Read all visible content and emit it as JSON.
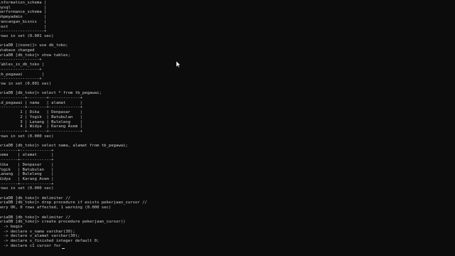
{
  "terminal": {
    "lines": [
      "information_schema |",
      "mysql              |",
      "performance_schema |",
      "phpmyadmin         |",
      "rancangan_bisnis   |",
      "test               |",
      "-------------------+",
      "rows in set (0.001 sec)",
      "",
      "ariaDB [(none)]> use db_toko;",
      "atabase changed",
      "ariaDB [db_toko]> show tables;",
      "-----------------+",
      "Tables_in_db_toko |",
      "-----------------+",
      "tb_pegawai        |",
      "-----------------+",
      "row in set (0.001 sec)",
      "",
      "ariaDB [db_toko]> select * from tb_pegawai;",
      "-----------+--------+-------------+",
      "id_pegawai | nama   | alamat      |",
      "-----------+--------+-------------+",
      "         1 | Dika   | Denpasar    |",
      "         2 | Yogik  | Batubulan   |",
      "         3 | Lanang | Buleleng    |",
      "         4 | Widya  | Karang Asem |",
      "-----------+--------+-------------+",
      "rows in set (0.000 sec)",
      "",
      "ariaDB [db_toko]> select nama, alamat from tb_pegawai;",
      "--------+-------------+",
      "nama    | alamat      |",
      "--------+-------------+",
      "Dika    | Denpasar    |",
      "Yogik   | Batubulan   |",
      "Lanang  | Buleleng    |",
      "Widya   | Karang Asem |",
      "--------+-------------+",
      "rows in set (0.000 sec)",
      "",
      "ariaDB [db_toko]> delimiter //",
      "ariaDB [db_toko]> drop procedure if exists pekerjaan_cursor //",
      "uery OK, 0 rows affected, 1 warning (0.000 sec)",
      "",
      "ariaDB [db_toko]> delimiter //",
      "ariaDB [db_toko]> create procedure pekerjaan_cursor()",
      "  -> begin",
      "  -> declare v_nama varchar(30);",
      "  -> declare v_alamat varchar(30);",
      "  -> declare v_finished integer default 0;",
      "  -> declare c1 cursor for"
    ]
  },
  "colors": {
    "background": "#0c0c0c",
    "text": "#cccccc"
  },
  "icons": {
    "pointer": "mouse-pointer-icon"
  }
}
